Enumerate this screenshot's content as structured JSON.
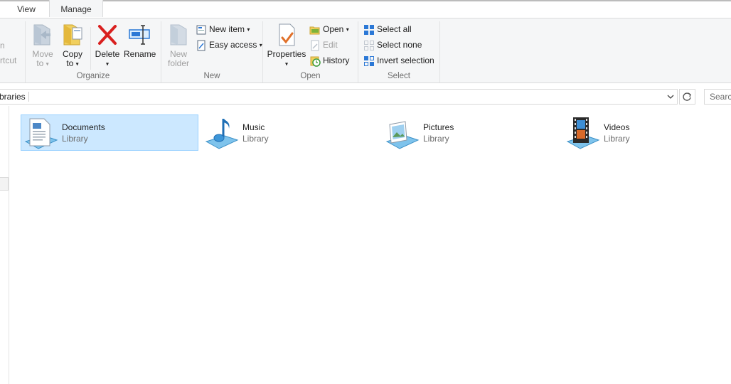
{
  "tabs": {
    "view": "View",
    "manage": "Manage"
  },
  "ribbon": {
    "clipboard_partial": {
      "item1": "n",
      "item2": "rtcut"
    },
    "organize": {
      "label": "Organize",
      "move_to": [
        "Move",
        "to"
      ],
      "copy_to": [
        "Copy",
        "to"
      ],
      "delete": "Delete",
      "rename": "Rename"
    },
    "new": {
      "label": "New",
      "new_folder": [
        "New",
        "folder"
      ],
      "new_item": "New item",
      "easy_access": "Easy access"
    },
    "open": {
      "label": "Open",
      "properties": "Properties",
      "open": "Open",
      "edit": "Edit",
      "history": "History"
    },
    "select": {
      "label": "Select",
      "select_all": "Select all",
      "select_none": "Select none",
      "invert_selection": "Invert selection"
    }
  },
  "address": {
    "path": "braries",
    "search_placeholder": "Searc"
  },
  "libraries": [
    {
      "name": "Documents",
      "type": "Library",
      "selected": true,
      "icon": "documents-library-icon"
    },
    {
      "name": "Music",
      "type": "Library",
      "selected": false,
      "icon": "music-library-icon"
    },
    {
      "name": "Pictures",
      "type": "Library",
      "selected": false,
      "icon": "pictures-library-icon"
    },
    {
      "name": "Videos",
      "type": "Library",
      "selected": false,
      "icon": "videos-library-icon"
    }
  ],
  "colors": {
    "ribbon_bg": "#f5f6f7",
    "selection_bg": "#cce8ff",
    "selection_border": "#99d1ff",
    "delete_red": "#d9201f",
    "accent_blue": "#2b78d6"
  }
}
